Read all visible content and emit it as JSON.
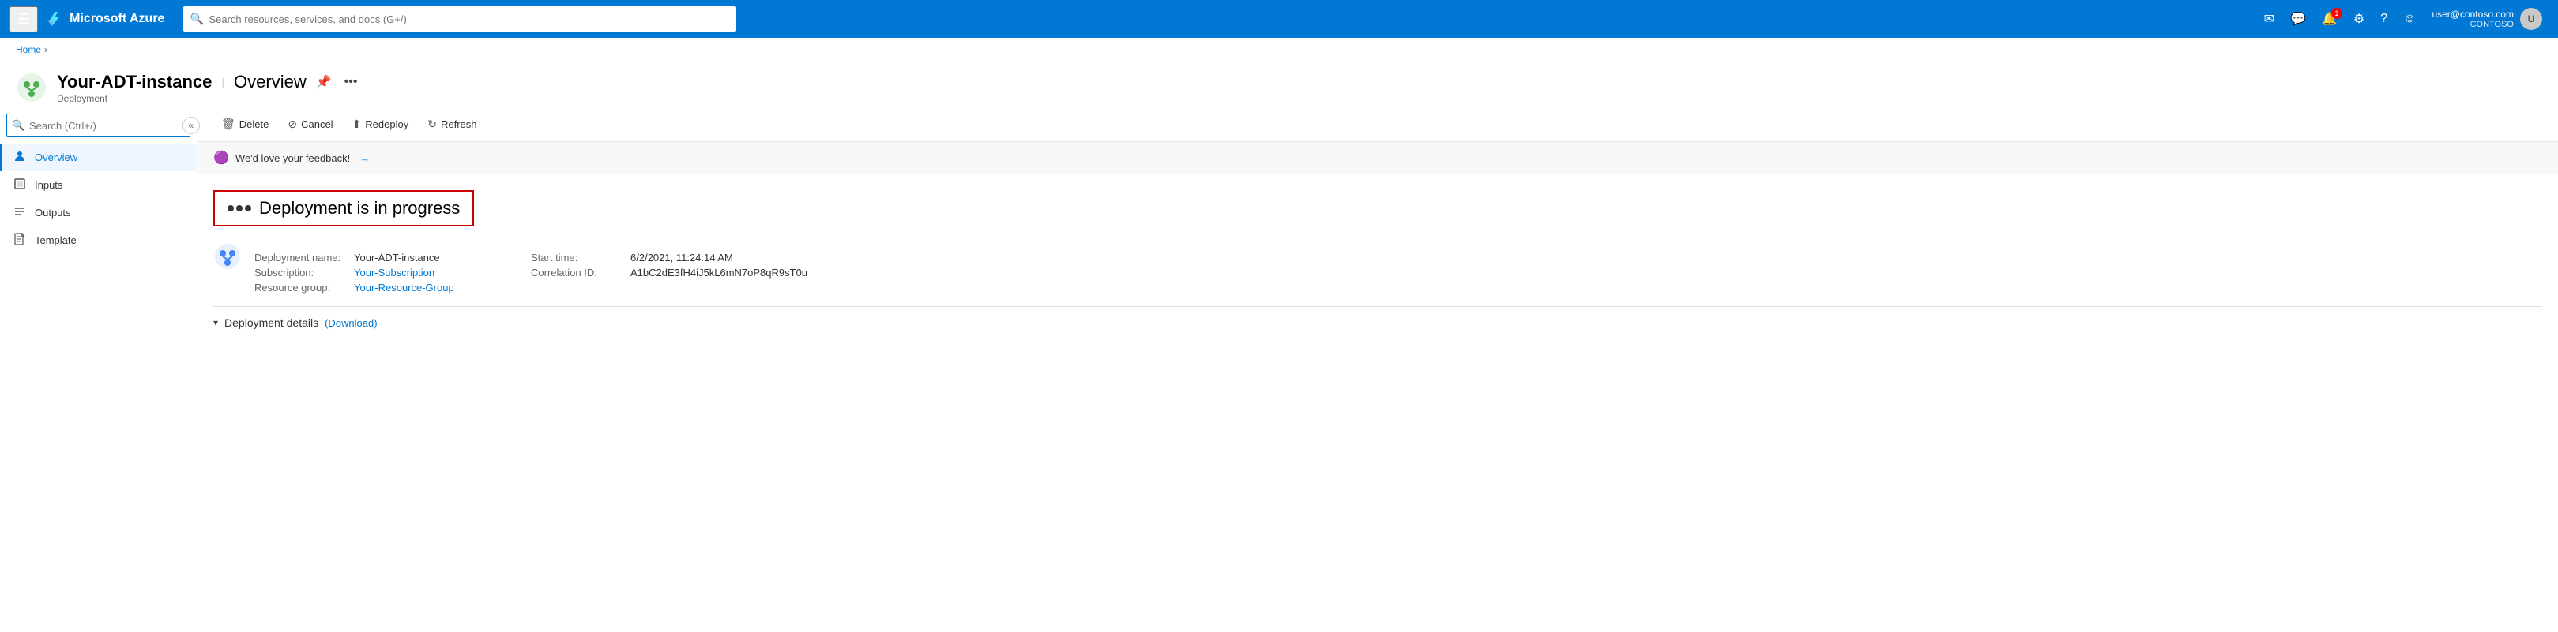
{
  "topNav": {
    "hamburger_label": "☰",
    "logo_text": "Microsoft Azure",
    "search_placeholder": "Search resources, services, and docs (G+/)",
    "notifications_count": "1",
    "user_email": "user@contoso.com",
    "user_tenant": "CONTOSO",
    "icons": {
      "email": "✉",
      "feedback": "💬",
      "notifications": "🔔",
      "settings": "⚙",
      "help": "?",
      "smiley": "☺"
    }
  },
  "breadcrumb": {
    "items": [
      "Home"
    ],
    "separator": "›"
  },
  "pageHeader": {
    "title": "Your-ADT-instance",
    "divider": "|",
    "subtitle": "Overview",
    "subtitle_small": "Deployment",
    "pin_icon": "📌",
    "more_icon": "•••"
  },
  "sidebar": {
    "search_placeholder": "Search (Ctrl+/)",
    "collapse_icon": "«",
    "items": [
      {
        "id": "overview",
        "label": "Overview",
        "icon": "👤",
        "active": true
      },
      {
        "id": "inputs",
        "label": "Inputs",
        "icon": "⬛"
      },
      {
        "id": "outputs",
        "label": "Outputs",
        "icon": "≡"
      },
      {
        "id": "template",
        "label": "Template",
        "icon": "📄"
      }
    ]
  },
  "toolbar": {
    "buttons": [
      {
        "id": "delete",
        "label": "Delete",
        "icon": "🗑"
      },
      {
        "id": "cancel",
        "label": "Cancel",
        "icon": "⊘"
      },
      {
        "id": "redeploy",
        "label": "Redeploy",
        "icon": "⬆"
      },
      {
        "id": "refresh",
        "label": "Refresh",
        "icon": "↻"
      }
    ]
  },
  "feedback": {
    "text": "We'd love your feedback!",
    "arrow": "→"
  },
  "deployment": {
    "status_text": "Deployment is in progress",
    "name_label": "Deployment name:",
    "name_value": "Your-ADT-instance",
    "subscription_label": "Subscription:",
    "subscription_value": "Your-Subscription",
    "resource_group_label": "Resource group:",
    "resource_group_value": "Your-Resource-Group",
    "start_time_label": "Start time:",
    "start_time_value": "6/2/2021, 11:24:14 AM",
    "correlation_label": "Correlation ID:",
    "correlation_value": "A1bC2dE3fH4iJ5kL6mN7oP8qR9sT0u",
    "details_label": "Deployment details",
    "download_label": "(Download)"
  }
}
